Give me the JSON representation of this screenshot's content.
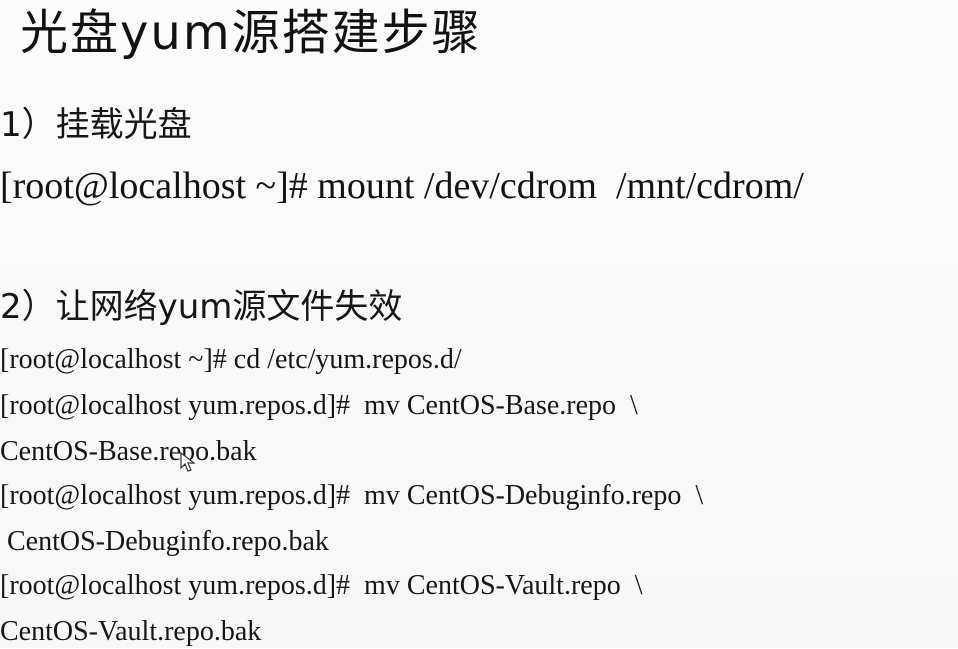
{
  "slide": {
    "title": "光盘yum源搭建步骤",
    "step1": "1）挂载光盘",
    "mount_command": "[root@localhost ~]# mount /dev/cdrom  /mnt/cdrom/",
    "step2": "2）让网络yum源文件失效",
    "commands": [
      "[root@localhost ~]# cd /etc/yum.repos.d/",
      "[root@localhost yum.repos.d]#  mv CentOS-Base.repo  \\",
      "CentOS-Base.repo.bak",
      "[root@localhost yum.repos.d]#  mv CentOS-Debuginfo.repo  \\",
      " CentOS-Debuginfo.repo.bak",
      "[root@localhost yum.repos.d]#  mv CentOS-Vault.repo  \\",
      "CentOS-Vault.repo.bak"
    ]
  },
  "icons": {
    "cursor": "mouse-pointer-icon"
  }
}
